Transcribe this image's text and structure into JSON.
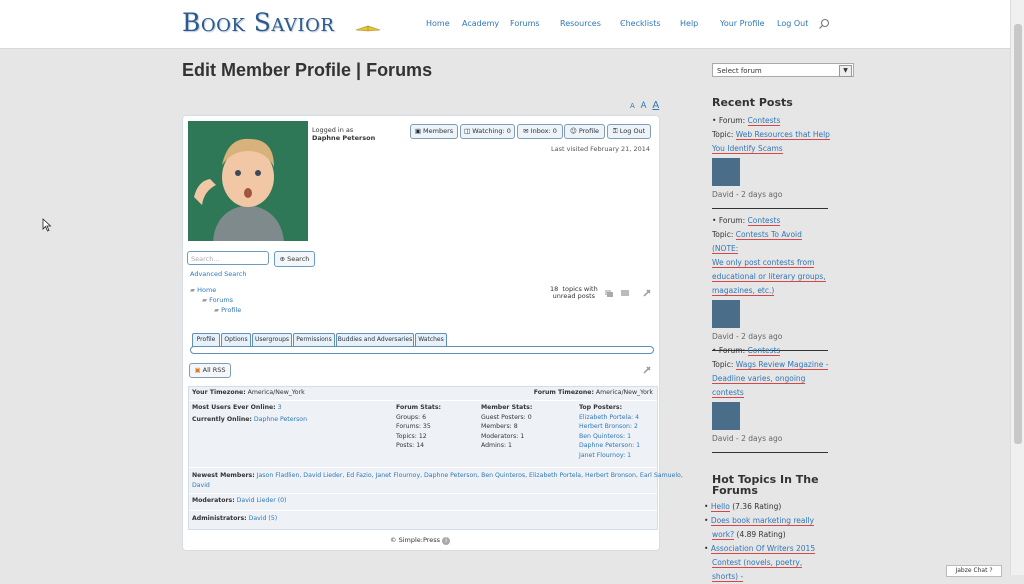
{
  "site": {
    "logo": "Book Savior"
  },
  "nav": {
    "items": [
      {
        "label": "Home",
        "has_sub": false
      },
      {
        "label": "Academy",
        "has_sub": false
      },
      {
        "label": "Forums",
        "has_sub": true
      },
      {
        "label": "Resources",
        "has_sub": true
      },
      {
        "label": "Checklists",
        "has_sub": true
      },
      {
        "label": "Help",
        "has_sub": true
      },
      {
        "label": "Your Profile",
        "has_sub": false
      },
      {
        "label": "Log Out",
        "has_sub": false
      }
    ],
    "caret": "⌄"
  },
  "page": {
    "title": "Edit Member Profile | Forums"
  },
  "fontsize": {
    "small": "A",
    "medium": "A",
    "large": "A"
  },
  "forum": {
    "logged_in_label": "Logged in as",
    "user": "Daphne Peterson",
    "toolbar": {
      "members": "Members",
      "watching": "Watching: 0",
      "inbox": "Inbox: 0",
      "profile": "Profile",
      "logout": "Log Out"
    },
    "last_visited": "Last visited February 21, 2014",
    "search_placeholder": "Search...",
    "search_button": "Search",
    "advanced_search": "Advanced Search",
    "breadcrumb": [
      "Home",
      "Forums",
      "Profile"
    ],
    "unread": {
      "count": "18",
      "text1": "topics with",
      "text2": "unread posts"
    },
    "tabs": [
      "Profile",
      "Options",
      "Usergroups",
      "Permissions",
      "Buddies and Adversaries",
      "Watches"
    ],
    "rss": "All RSS",
    "stats": {
      "your_tz_label": "Your Timezone:",
      "your_tz": "America/New_York",
      "forum_tz_label": "Forum Timezone:",
      "forum_tz": "America/New_York",
      "most_users_label": "Most Users Ever Online:",
      "most_users": "3",
      "currently_online_label": "Currently Online:",
      "currently_online": "Daphne Peterson",
      "forum_stats": {
        "title": "Forum Stats:",
        "groups": "Groups: 6",
        "forums": "Forums: 35",
        "topics": "Topics: 12",
        "posts": "Posts: 14"
      },
      "member_stats": {
        "title": "Member Stats:",
        "guest": "Guest Posters: 0",
        "members": "Members: 8",
        "moderators": "Moderators: 1",
        "admins": "Admins: 1"
      },
      "top_posters": {
        "title": "Top Posters:",
        "list": [
          "Elizabeth Portela: 4",
          "Herbert Bronson: 2",
          "Ben Quinteros: 1",
          "Daphne Peterson: 1",
          "Janet Flournoy: 1"
        ]
      },
      "newest_label": "Newest Members:",
      "newest_1": "Jason Fladlien, David Lieder, Ed Fazio, Janet Flournoy, Daphne Peterson, Ben Quinteros, Elizabeth Portela, Herbert Bronson, Earl Samuelo,",
      "newest_2": "David",
      "moderators_label": "Moderators:",
      "moderators": "David Lieder (0)",
      "administrators_label": "Administrators:",
      "administrators": "David (5)"
    },
    "footer": "© Simple:Press"
  },
  "sidebar": {
    "select_forum": "Select forum",
    "recent_title": "Recent Posts",
    "forum_label": "Forum:",
    "topic_label": "Topic:",
    "posts": [
      {
        "forum": "Contests",
        "topic_lines": [
          "Web Resources that Help",
          "You Identify Scams"
        ],
        "meta": "David - 2 days ago"
      },
      {
        "forum": "Contests",
        "topic_lines": [
          "Contests To Avoid (NOTE:",
          "We only post contests from",
          "educational or literary groups,",
          "magazines, etc.)"
        ],
        "meta": "David - 2 days ago"
      },
      {
        "forum": "Contests",
        "topic_lines": [
          "Wags Review Magazine -",
          "Deadline varies, ongoing",
          "contests"
        ],
        "meta": "David - 2 days ago"
      }
    ],
    "hot_title_1": "Hot Topics In The",
    "hot_title_2": "Forums",
    "hot": [
      {
        "lines": [
          "Hello"
        ],
        "rating": " (7.36 Rating)"
      },
      {
        "lines": [
          "Does book marketing really",
          "work?"
        ],
        "rating": " (4.89 Rating)"
      },
      {
        "lines": [
          "Association Of Writers 2015",
          "Contest (novels, poetry, shorts) -"
        ],
        "rating": ""
      }
    ]
  },
  "chat": {
    "label": "Jabze Chat ?"
  },
  "colors": {
    "link": "#2e77b8",
    "background": "#e6e6e6",
    "panel": "#ffffff"
  }
}
